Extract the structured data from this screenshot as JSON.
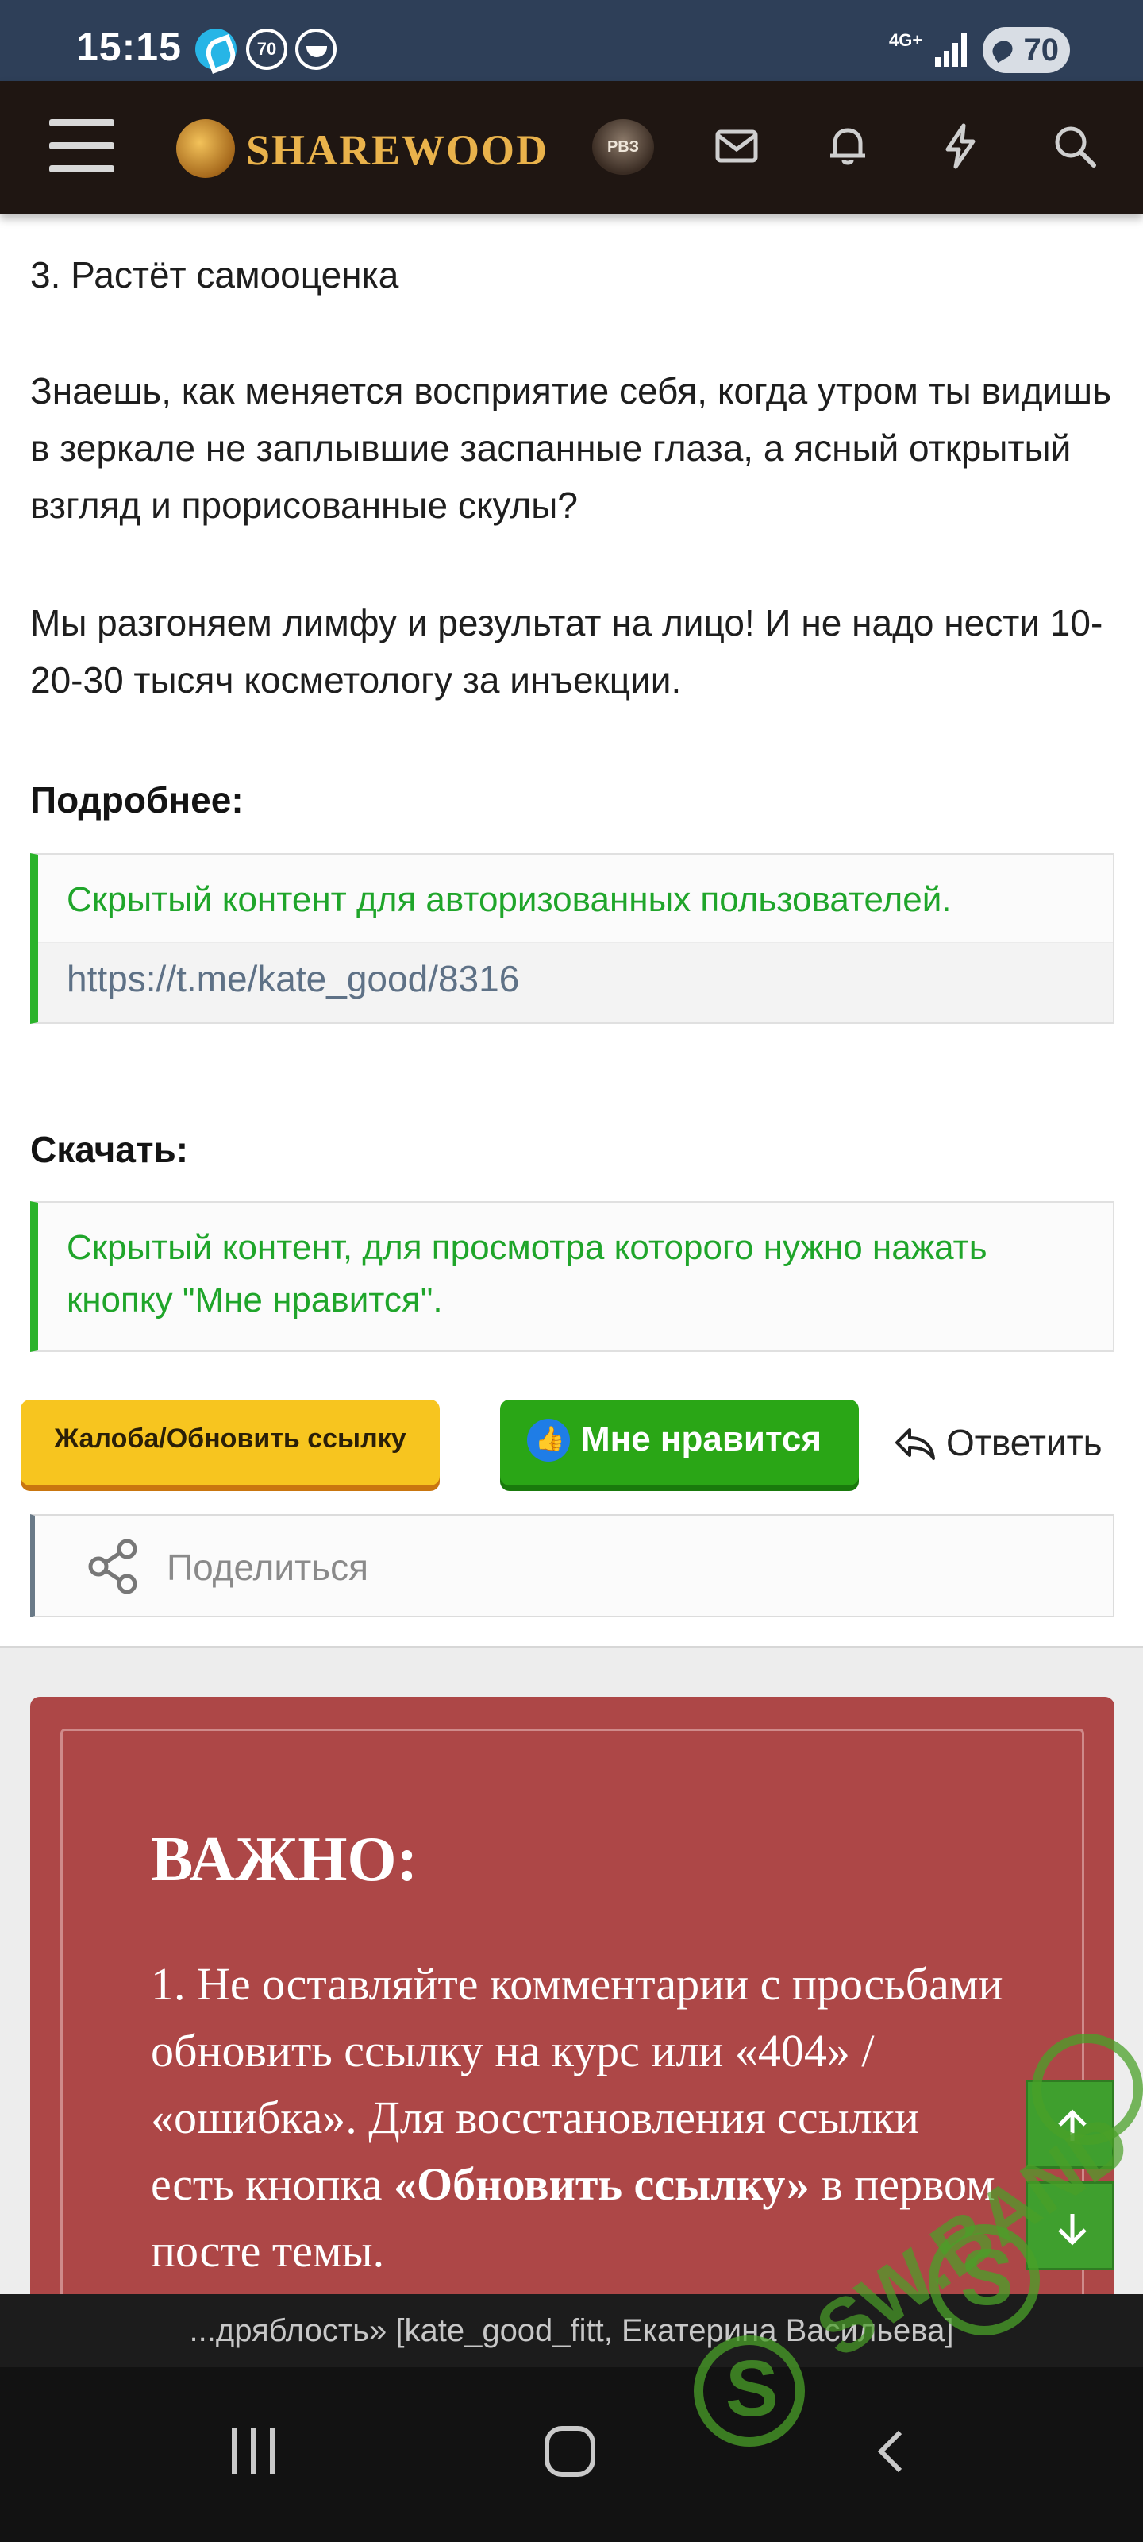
{
  "status_bar": {
    "time": "15:15",
    "notification_badge": "70",
    "network": "4G+",
    "battery": "70"
  },
  "header": {
    "logo_text": "SHAREWOOD",
    "logo_seal": "РВЗ",
    "icons": [
      "menu-icon",
      "mail-icon",
      "bell-icon",
      "bolt-icon",
      "search-icon"
    ]
  },
  "post": {
    "paragraphs": [
      "3. Растёт самооценка",
      "Знаешь, как меняется восприятие себя, когда утром ты видишь в зеркале не заплывшие заспанные глаза, а ясный открытый взгляд и прорисованные скулы?",
      "Мы разгоняем лимфу и результат на лицо! И не надо нести 10-20-30 тысяч косметологу за инъекции."
    ],
    "more_heading": "Подробнее:",
    "hidden_authorized": "Скрытый контент для авторизованных пользователей.",
    "link": "https://t.me/kate_good/8316",
    "download_heading": "Скачать:",
    "hidden_like": "Скрытый контент, для просмотра которого нужно нажать кнопку \"Мне нравится\"."
  },
  "actions": {
    "report_label": "Жалоба/Обновить ссылку",
    "like_label": "Мне нравится",
    "reply_label": "Ответить",
    "share_label": "Поделиться"
  },
  "notice": {
    "title": "ВАЖНО:",
    "text_before": "1. Не оставляйте комментарии с просьбами обновить ссылку на курс или «404» / «ошибка». Для восстановления ссылки есть кнопка ",
    "text_bold": "«Обновить ссылку»",
    "text_after": " в первом посте темы."
  },
  "footer": {
    "thread_title": "...дряблость» [kate_good_fitt, Екатерина Васильева]"
  },
  "watermark": {
    "text": "SW.BAND"
  },
  "colors": {
    "status_bar": "#2e3f58",
    "header": "#1f1612",
    "accent_green": "#2aa616",
    "report_yellow": "#f7c51f",
    "notice_red": "#ad4747"
  }
}
